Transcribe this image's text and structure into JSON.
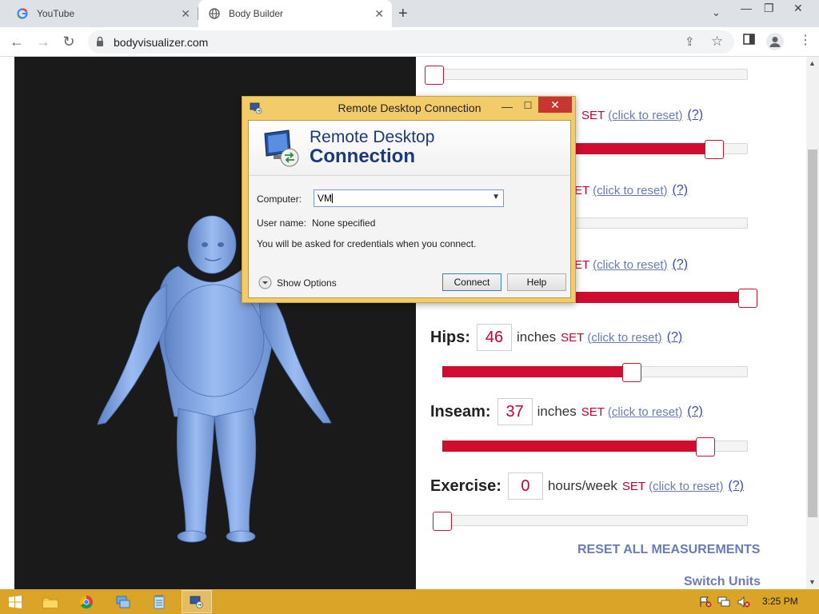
{
  "browser": {
    "tabs": [
      {
        "title": "YouTube",
        "icon": "google-g-icon"
      },
      {
        "title": "Body Builder",
        "icon": "globe-icon"
      }
    ],
    "url": "bodyvisualizer.com",
    "new_tab_label": "+"
  },
  "measurements": {
    "partial_rows": [
      {
        "set": "SET",
        "reset": "(click to reset)",
        "help": "(?)"
      },
      {
        "set": "ET",
        "reset": "(click to reset)",
        "help": "(?)"
      },
      {
        "set": "ET",
        "reset": "(click to reset)",
        "help": "(?)"
      }
    ],
    "slider_fill_fractions": [
      0.0,
      0.89,
      0.45,
      1.0
    ],
    "hips": {
      "label": "Hips:",
      "value": "46",
      "unit": "inches",
      "set": "SET",
      "reset": "(click to reset)",
      "help": "(?)",
      "slider_fraction": 0.62
    },
    "inseam": {
      "label": "Inseam:",
      "value": "37",
      "unit": "inches",
      "set": "SET",
      "reset": "(click to reset)",
      "help": "(?)",
      "slider_fraction": 0.86
    },
    "exercise": {
      "label": "Exercise:",
      "value": "0",
      "unit": "hours/week",
      "set": "SET",
      "reset": "(click to reset)",
      "help": "(?)",
      "slider_fraction": 0.0
    },
    "reset_all": "RESET ALL MEASUREMENTS",
    "switch_units": "Switch Units"
  },
  "rdp": {
    "window_title": "Remote Desktop Connection",
    "banner_line1": "Remote Desktop",
    "banner_line2": "Connection",
    "computer_label": "Computer:",
    "computer_value": "VM",
    "username_label": "User name:",
    "username_value": "None specified",
    "credentials_note": "You will be asked for credentials when you connect.",
    "show_options": "Show Options",
    "connect_button": "Connect",
    "help_button": "Help"
  },
  "taskbar": {
    "clock": "3:25 PM",
    "apps": [
      "file-explorer-icon",
      "chrome-icon",
      "network-icon",
      "notepad-icon",
      "remote-desktop-icon"
    ]
  },
  "colors": {
    "accent_red": "#d00c30",
    "link_blue": "#6b7caf",
    "model_blue": "#8fb1ea",
    "taskbar": "#d9a428"
  }
}
